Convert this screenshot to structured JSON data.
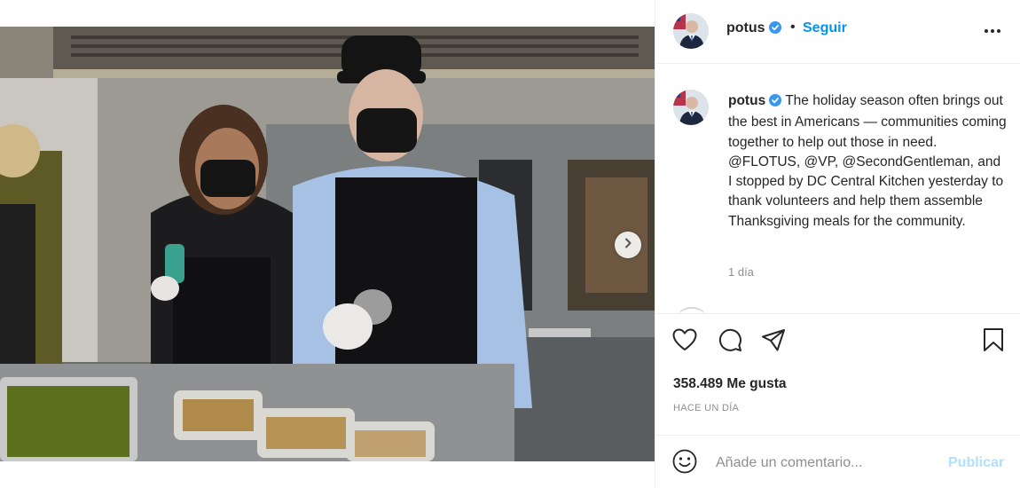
{
  "post": {
    "photo_alt": "",
    "carousel_next_icon": "chevron-right-icon"
  },
  "header": {
    "username": "potus",
    "verified_icon": "verified-badge-icon",
    "separator": "•",
    "follow_label": "Seguir",
    "more_icon": "more-options-icon"
  },
  "caption": {
    "username": "potus",
    "text": "The holiday season often brings out the best in Americans — communities coming together to help out those in need. @FLOTUS, @VP, @SecondGentleman, and I stopped by DC Central Kitchen yesterday to thank volunteers and help them assemble Thanksgiving meals for the community.",
    "time": "1 día"
  },
  "actions": {
    "like_icon": "heart-icon",
    "comment_icon": "comment-icon",
    "share_icon": "share-icon",
    "save_icon": "bookmark-icon"
  },
  "likes": "358.489 Me gusta",
  "post_date": "HACE UN DÍA",
  "comment": {
    "emoji_icon": "emoji-icon",
    "placeholder": "Añade un comentario...",
    "publish_label": "Publicar"
  },
  "colors": {
    "accent": "#0095f6",
    "publish_disabled": "#b2dffc",
    "text": "#262626",
    "muted": "#8e8e8e",
    "border": "#efefef"
  }
}
